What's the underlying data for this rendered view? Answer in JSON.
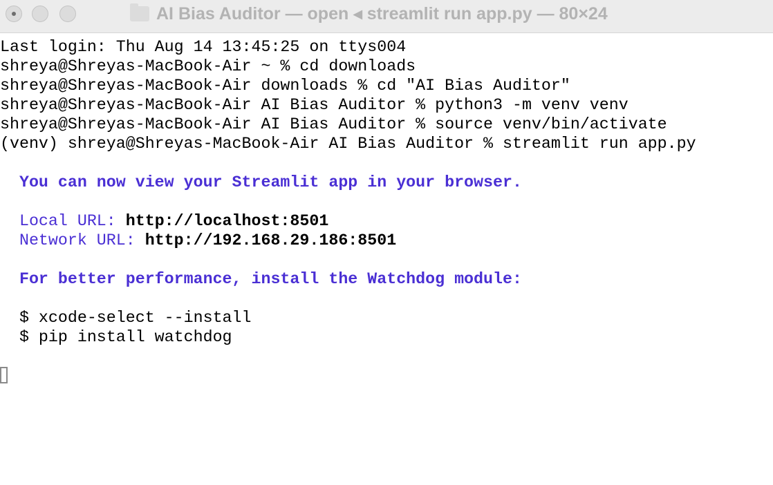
{
  "window": {
    "title": "AI Bias Auditor — open ◂ streamlit run app.py — 80×24",
    "title_icon": "folder-icon",
    "traffic_lights": [
      "close",
      "minimize",
      "zoom"
    ]
  },
  "terminal": {
    "lines": [
      "Last login: Thu Aug 14 13:45:25 on ttys004",
      "shreya@Shreyas-MacBook-Air ~ % cd downloads",
      "shreya@Shreyas-MacBook-Air downloads % cd \"AI Bias Auditor\"",
      "shreya@Shreyas-MacBook-Air AI Bias Auditor % python3 -m venv venv",
      "shreya@Shreyas-MacBook-Air AI Bias Auditor % source venv/bin/activate",
      "(venv) shreya@Shreyas-MacBook-Air AI Bias Auditor % streamlit run app.py"
    ],
    "view_message": "  You can now view your Streamlit app in your browser.",
    "local_label": "  Local URL: ",
    "local_url": "http://localhost:8501",
    "network_label": "  Network URL: ",
    "network_url": "http://192.168.29.186:8501",
    "perf_message": "  For better performance, install the Watchdog module:",
    "hint_lines": [
      "  $ xcode-select --install",
      "  $ pip install watchdog"
    ],
    "accent_color": "#4a2fd4"
  }
}
